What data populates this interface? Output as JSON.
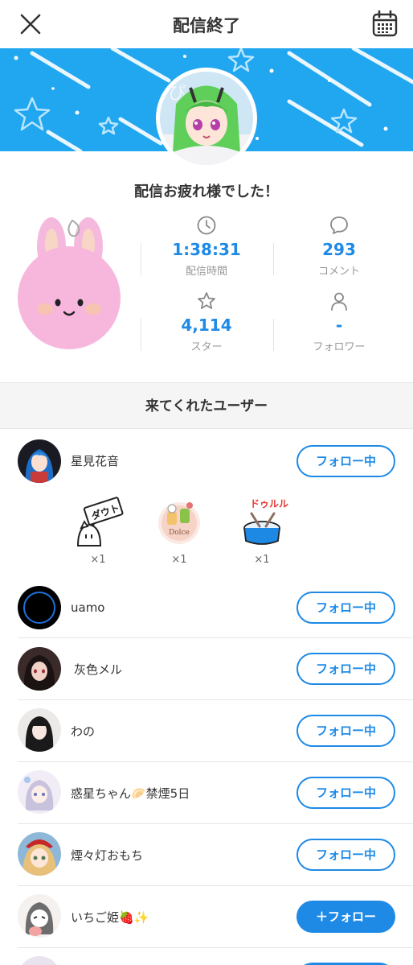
{
  "header": {
    "title": "配信終了",
    "close_icon": "close-icon",
    "calendar_icon": "calendar-icon"
  },
  "banner": {
    "color": "#21a6f0"
  },
  "message": "配信お疲れ様でした！",
  "stats": {
    "duration": {
      "icon": "clock-icon",
      "value": "1:38:31",
      "label": "配信時間"
    },
    "comments": {
      "icon": "comment-icon",
      "value": "293",
      "label": "コメント"
    },
    "stars": {
      "icon": "star-icon",
      "value": "4,114",
      "label": "スター"
    },
    "followers": {
      "icon": "person-icon",
      "value": "-",
      "label": "フォロワー"
    }
  },
  "visitors": {
    "title": "来てくれたユーザー",
    "users": [
      {
        "name": "星見花音",
        "button": "フォロー中",
        "gifts": [
          {
            "icon": "sign-ghost-icon",
            "count": "×1"
          },
          {
            "icon": "cake-sticker-icon",
            "count": "×1"
          },
          {
            "icon": "drum-icon",
            "count": "×1"
          }
        ]
      },
      {
        "name": "uamo",
        "button": "フォロー中"
      },
      {
        "name": "灰色メル",
        "button": "フォロー中"
      },
      {
        "name": "わの",
        "button": "フォロー中"
      },
      {
        "name": "惑星ちゃん🥟禁煙5日",
        "button": "フォロー中"
      },
      {
        "name": "煙々灯おもち",
        "button": "フォロー中"
      },
      {
        "name": "いちご姫🍓✨",
        "button": "＋フォロー"
      }
    ]
  },
  "accent_color": "#1e8ae6"
}
